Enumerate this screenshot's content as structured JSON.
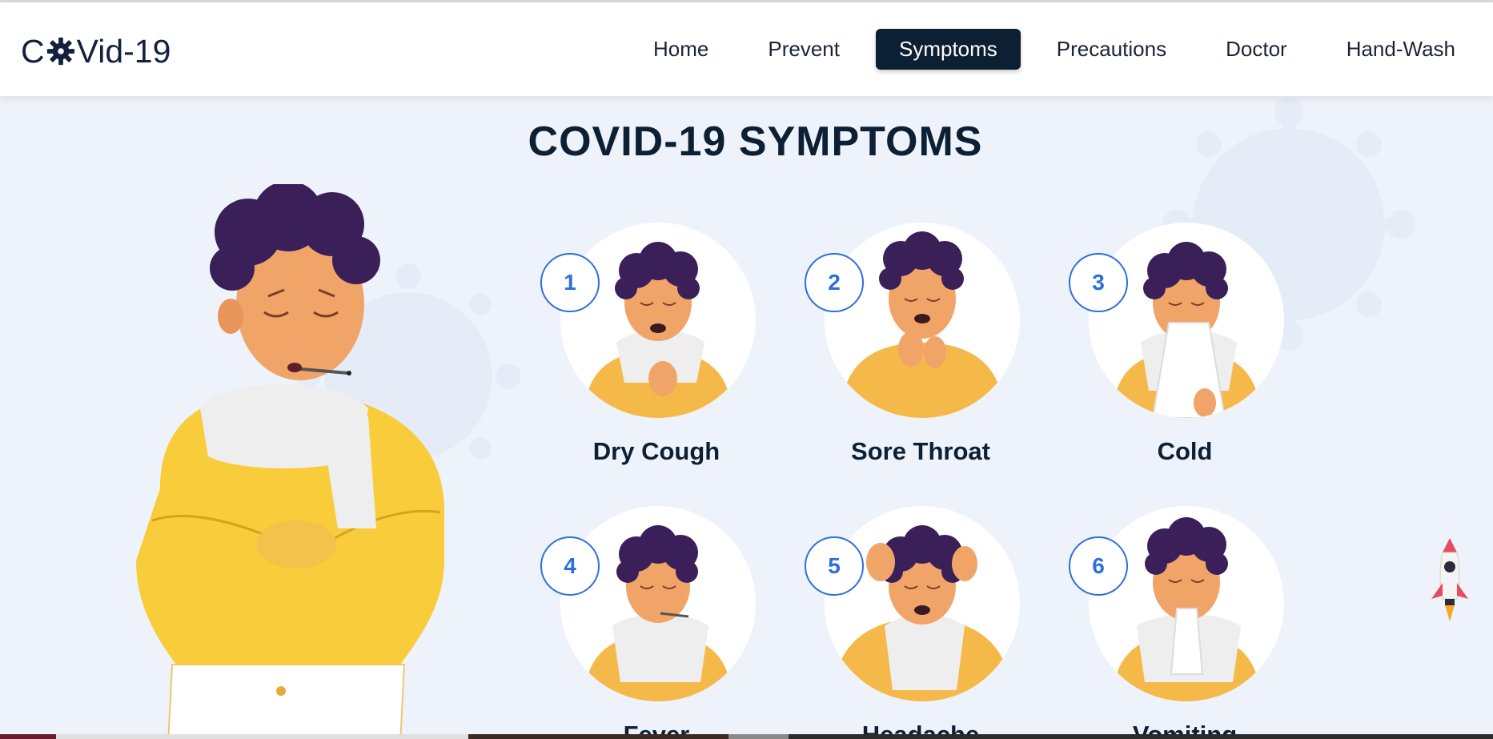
{
  "brand": {
    "prefix": "C",
    "suffix": "Vid-19",
    "icon": "virus-gear-icon"
  },
  "nav": {
    "items": [
      {
        "label": "Home",
        "active": false
      },
      {
        "label": "Prevent",
        "active": false
      },
      {
        "label": "Symptoms",
        "active": true
      },
      {
        "label": "Precautions",
        "active": false
      },
      {
        "label": "Doctor",
        "active": false
      },
      {
        "label": "Hand-Wash",
        "active": false
      }
    ]
  },
  "main": {
    "title": "COVID-19 SYMPTOMS",
    "symptoms": [
      {
        "num": "1",
        "label": "Dry Cough"
      },
      {
        "num": "2",
        "label": "Sore Throat"
      },
      {
        "num": "3",
        "label": "Cold"
      },
      {
        "num": "4",
        "label": "Fever"
      },
      {
        "num": "5",
        "label": "Headache"
      },
      {
        "num": "6",
        "label": "Vomiting"
      }
    ]
  },
  "colors": {
    "accent": "#2d6fe0",
    "navy": "#0c1f33",
    "background": "#eef3fb",
    "sweater": "#f9cc3c",
    "hair": "#3b1f59",
    "skin": "#f0a468"
  },
  "scroll_top_icon": "rocket-icon"
}
